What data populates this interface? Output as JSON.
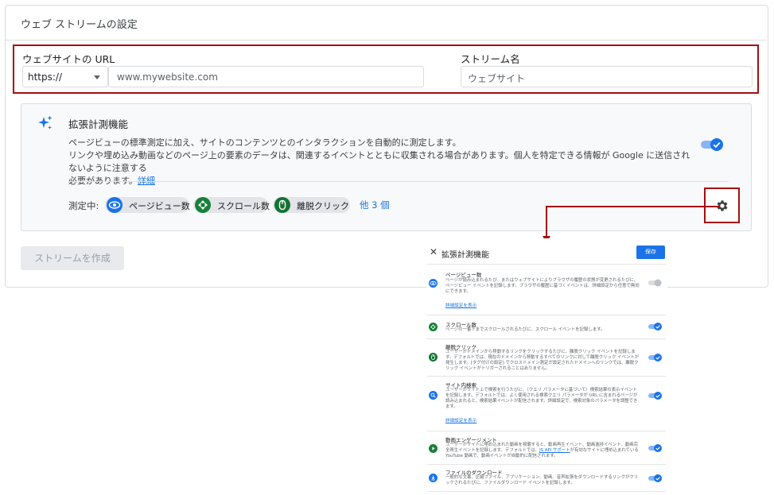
{
  "header": {
    "title": "ウェブ ストリームの設定"
  },
  "url_section": {
    "url_label": "ウェブサイトの URL",
    "protocol": "https://",
    "url_placeholder": "www.mywebsite.com",
    "stream_label": "ストリーム名",
    "stream_placeholder": "ウェブサイト"
  },
  "enhanced": {
    "title": "拡張計測機能",
    "desc_line1": "ページビューの標準測定に加え、サイトのコンテンツとのインタラクションを自動的に測定します。",
    "desc_line2": "リンクや埋め込み動画などのページ上の要素のデータは、関連するイベントとともに収集される場合があります。個人を特定できる情報が Google に送信されないように注意する",
    "desc_line3": "必要があります。",
    "details_link": "詳細",
    "enabled": true,
    "measuring_label": "測定中:",
    "chips": [
      "ページビュー数",
      "スクロール数",
      "離脱クリック"
    ],
    "more": "他 3 個",
    "settings_icon": "gear-icon"
  },
  "create_button": "ストリームを作成",
  "detail_panel": {
    "close": "✕",
    "title": "拡張計測機能",
    "save": "保存",
    "show_details": "詳細設定を表示",
    "items": [
      {
        "title": "ページビュー数",
        "desc": "ページが読み込まれるたび、またはウェブサイトによりブラウザの履歴の状態が変更されるたびに、ページビュー イベントを記録します。ブラウザの履歴に基づくイベントは、詳細設定から任意で無効にできます。",
        "enabled": false,
        "icon": "eye-icon",
        "color": "#1a73e8"
      },
      {
        "title": "スクロール数",
        "desc": "ページの一番下までスクロールされるたびに、スクロール イベントを記録します。",
        "enabled": true,
        "icon": "scroll-icon",
        "color": "#188038"
      },
      {
        "title": "離脱クリック",
        "desc": "ユーザーがドメインから移動するリンクをクリックするたびに、離脱クリック イベントを記録します。デフォルトでは、現在のドメインから移動するすべてのリンクに対して離脱クリック イベントが発生します。[タグ付けの設定] でクロスドメイン測定が設定されたドメインへのリンクでは、離脱クリック イベントがトリガーされることはありません。",
        "enabled": true,
        "icon": "mouse-icon",
        "color": "#137333"
      },
      {
        "title": "サイト内検索",
        "desc": "ユーザーがサイト上で検索を行うたびに、（クエリ パラメータに基づいて）検索結果の表示イベントを記録します。デフォルトでは、よく使用される検索クエリ パラメータが URL に含まれるページが読み込まれると、検索結果イベントが配信されます。詳細設定で、検索対象のパラメータを調整できます。",
        "enabled": true,
        "icon": "search-icon",
        "color": "#1a73e8"
      },
      {
        "title": "動画エンゲージメント",
        "desc_pre": "ユーザーがサイトに埋め込まれた動画を視聴すると、動画再生イベント、動画進捗イベント、動画完全再生イベントを記録します。デフォルトでは、",
        "desc_link": "JS API サポート",
        "desc_post": "が有効なサイトに埋め込まれている YouTube 動画で、動画イベントが自動的に配信されます。",
        "enabled": true,
        "icon": "play-icon",
        "color": "#188038"
      },
      {
        "title": "ファイルのダウンロード",
        "desc": "一般的な文書、圧縮ファイル、アプリケーション、動画、音声拡張をダウンロードするリンクがクリックされるたびに、ファイルダウンロード イベントを記録します。",
        "enabled": true,
        "icon": "download-icon",
        "color": "#1a73e8"
      }
    ]
  }
}
